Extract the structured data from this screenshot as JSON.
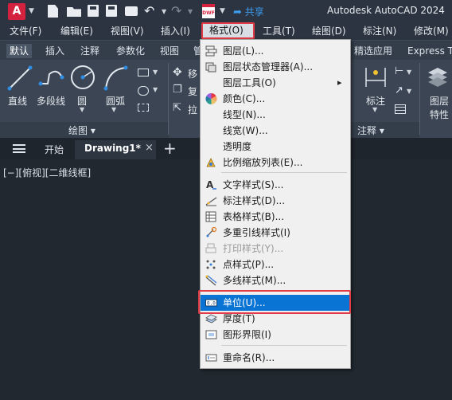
{
  "app": {
    "title": "Autodesk AutoCAD 2024",
    "logo_letter": "A",
    "share_label": "共享",
    "dwf_badge": "DWF"
  },
  "menubar": {
    "items": [
      "文件(F)",
      "编辑(E)",
      "视图(V)",
      "插入(I)",
      "格式(O)",
      "工具(T)",
      "绘图(D)",
      "标注(N)",
      "修改(M)"
    ]
  },
  "ribbon_tabs": {
    "items": [
      "默认",
      "插入",
      "注释",
      "参数化",
      "视图",
      "管",
      "精选应用",
      "Express T"
    ]
  },
  "ribbon": {
    "draw_tools": [
      "直线",
      "多段线",
      "圆",
      "圆弧"
    ],
    "draw_panel_label": "绘图 ▾",
    "partial_labels": [
      "移",
      "复",
      "拉"
    ],
    "annotation_tools": [
      "标注"
    ],
    "annotation_panel_label": "注释 ▾",
    "layer_tools": [
      "图层",
      "特性"
    ]
  },
  "doc_tabs": {
    "start_label": "开始",
    "drawing_label": "Drawing1*"
  },
  "viewport": {
    "label": "[−][俯视][二维线框]"
  },
  "format_menu": {
    "items": [
      {
        "label": "图层(L)...",
        "icon": "layers-icon"
      },
      {
        "label": "图层状态管理器(A)...",
        "icon": "layer-states-icon"
      },
      {
        "label": "图层工具(O)",
        "icon": "",
        "arrow": "▸"
      },
      {
        "label": "颜色(C)...",
        "icon": "color-wheel-icon"
      },
      {
        "label": "线型(N)...",
        "icon": ""
      },
      {
        "label": "线宽(W)...",
        "icon": ""
      },
      {
        "label": "透明度",
        "icon": ""
      },
      {
        "label": "比例缩放列表(E)...",
        "icon": "scale-list-icon"
      },
      {
        "label": "文字样式(S)...",
        "icon": "text-style-icon"
      },
      {
        "label": "标注样式(D)...",
        "icon": "dim-style-icon"
      },
      {
        "label": "表格样式(B)...",
        "icon": "table-style-icon"
      },
      {
        "label": "多重引线样式(I)",
        "icon": "mleader-style-icon"
      },
      {
        "label": "打印样式(Y)...",
        "icon": "plot-style-icon",
        "disabled": true
      },
      {
        "label": "点样式(P)...",
        "icon": "point-style-icon"
      },
      {
        "label": "多线样式(M)...",
        "icon": "mline-style-icon"
      },
      {
        "label": "单位(U)...",
        "icon": "units-icon",
        "selected": true
      },
      {
        "label": "厚度(T)",
        "icon": "thickness-icon"
      },
      {
        "label": "图形界限(I)",
        "icon": "limits-icon"
      },
      {
        "label": "重命名(R)...",
        "icon": "rename-icon"
      }
    ]
  },
  "colors": {
    "accent_highlight": "#e33b46",
    "selection_blue": "#0a74d4",
    "logo_red": "#d4213d"
  }
}
